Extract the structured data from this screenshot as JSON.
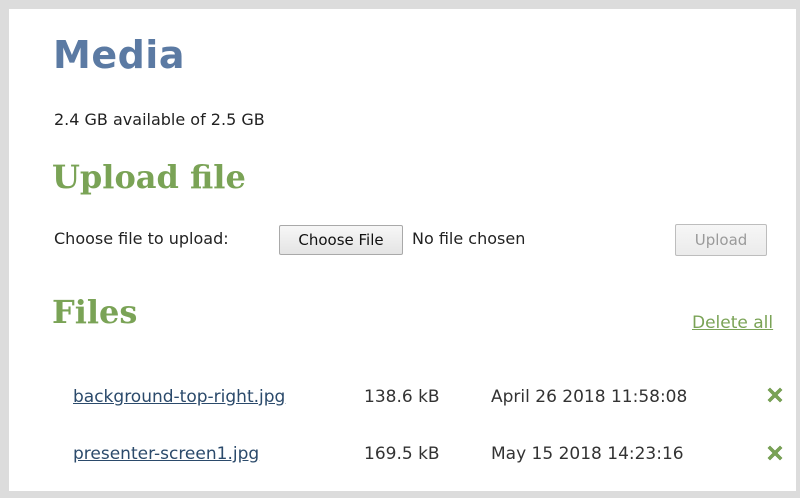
{
  "page": {
    "title": "Media",
    "storage_text": "2.4 GB available of 2.5 GB"
  },
  "upload": {
    "title": "Upload file",
    "choose_label": "Choose file to upload:",
    "choose_button": "Choose File",
    "no_file_text": "No file chosen",
    "upload_button": "Upload"
  },
  "files": {
    "title": "Files",
    "delete_all": "Delete all",
    "items": [
      {
        "name": "background-top-right.jpg",
        "size": "138.6 kB",
        "date": "April 26 2018 11:58:08",
        "delete_icon": "delete-x-icon"
      },
      {
        "name": "presenter-screen1.jpg",
        "size": "169.5 kB",
        "date": "May 15 2018 14:23:16",
        "delete_icon": "delete-x-icon"
      }
    ]
  },
  "colors": {
    "page_title": "#5b7aa3",
    "section_title": "#7aa356",
    "delete_icon": "#7aa356",
    "link": "#2b4a6b",
    "frame": "#dcdcdc"
  }
}
